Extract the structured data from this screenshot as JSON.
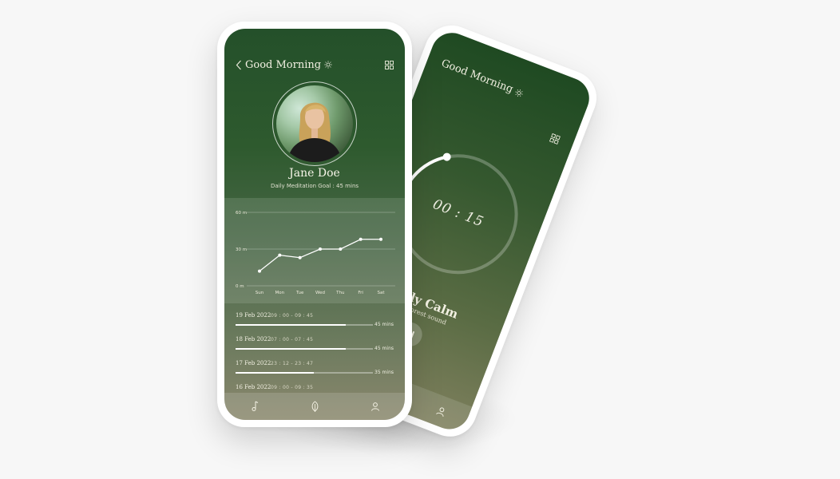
{
  "back_phone": {
    "greeting": "Good Morning",
    "timer": "00 : 15",
    "track_title": "Daily Calm",
    "track_subtitle": "Rain forest sound",
    "timer_progress": 0.3
  },
  "front_phone": {
    "greeting": "Good Morning",
    "user_name": "Jane Doe",
    "goal_text": "Daily Meditation Goal : 45 mins",
    "sessions": [
      {
        "date": "19 Feb 2022",
        "time": "09 : 00 - 09 : 45",
        "duration": "45 mins",
        "progress": 0.8
      },
      {
        "date": "18 Feb 2022",
        "time": "07 : 00 - 07 : 45",
        "duration": "45 mins",
        "progress": 0.8
      },
      {
        "date": "17 Feb 2022",
        "time": "23 : 12 - 23 : 47",
        "duration": "35 mins",
        "progress": 0.57
      },
      {
        "date": "16 Feb 2022",
        "time": "09 : 00 - 09 : 35",
        "duration": "",
        "progress": 0
      }
    ]
  },
  "chart_data": {
    "type": "line",
    "categories": [
      "Sun",
      "Mon",
      "Tue",
      "Wed",
      "Thu",
      "Fri",
      "Sat"
    ],
    "values": [
      12,
      25,
      23,
      30,
      30,
      38,
      38
    ],
    "y_ticks": [
      "0 m",
      "30 m",
      "60 m"
    ],
    "ylim": [
      0,
      60
    ],
    "grid": true
  },
  "colors": {
    "accent_green": "#24502a",
    "line": "#ffffff"
  },
  "icons": {
    "back": "chevron-left-icon",
    "sun": "sun-icon",
    "grid": "grid-icon",
    "music": "music-note-icon",
    "leaf": "leaf-icon",
    "profile": "user-icon",
    "pause": "pause-icon"
  }
}
